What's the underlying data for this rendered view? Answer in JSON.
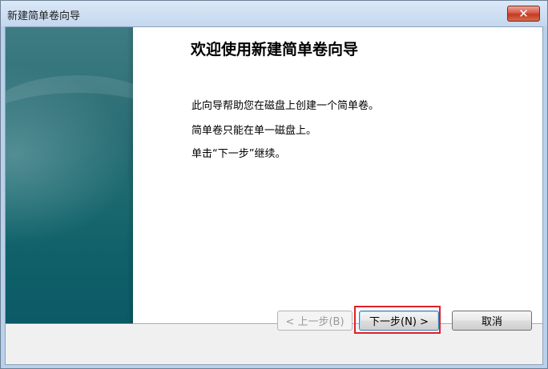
{
  "window": {
    "title": "新建简单卷向导",
    "close_glyph": "✕"
  },
  "wizard": {
    "heading": "欢迎使用新建简单卷向导",
    "paragraphs": [
      "此向导帮助您在磁盘上创建一个简单卷。",
      "简单卷只能在单一磁盘上。",
      "单击“下一步”继续。"
    ]
  },
  "buttons": {
    "back": "< 上一步(B)",
    "next": "下一步(N) >",
    "cancel": "取消"
  },
  "colors": {
    "banner_teal": "#1d6a70",
    "highlight_red": "#e0202a"
  }
}
